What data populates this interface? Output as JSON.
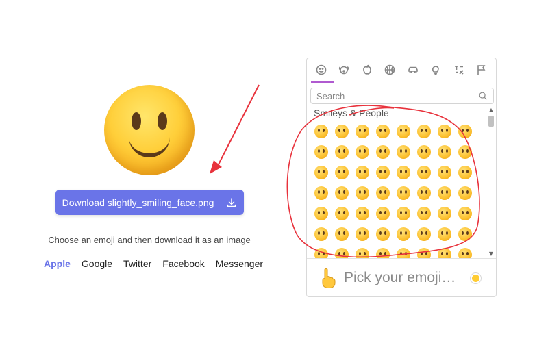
{
  "download": {
    "label": "Download slightly_smiling_face.png",
    "icon": "download-icon"
  },
  "hint": "Choose an emoji and then download it as an image",
  "platforms": [
    {
      "label": "Apple",
      "active": true
    },
    {
      "label": "Google",
      "active": false
    },
    {
      "label": "Twitter",
      "active": false
    },
    {
      "label": "Facebook",
      "active": false
    },
    {
      "label": "Messenger",
      "active": false
    }
  ],
  "picker": {
    "categories": [
      "smiley-icon",
      "dog-icon",
      "apple-icon",
      "basketball-icon",
      "car-icon",
      "lightbulb-icon",
      "symbols-icon",
      "flag-icon"
    ],
    "search_placeholder": "Search",
    "section_label": "Smileys & People",
    "preview_text": "Pick your emoji…",
    "accent": "#b05ad0"
  },
  "colors": {
    "button": "#6a74e8",
    "annotation": "#e8323c"
  }
}
